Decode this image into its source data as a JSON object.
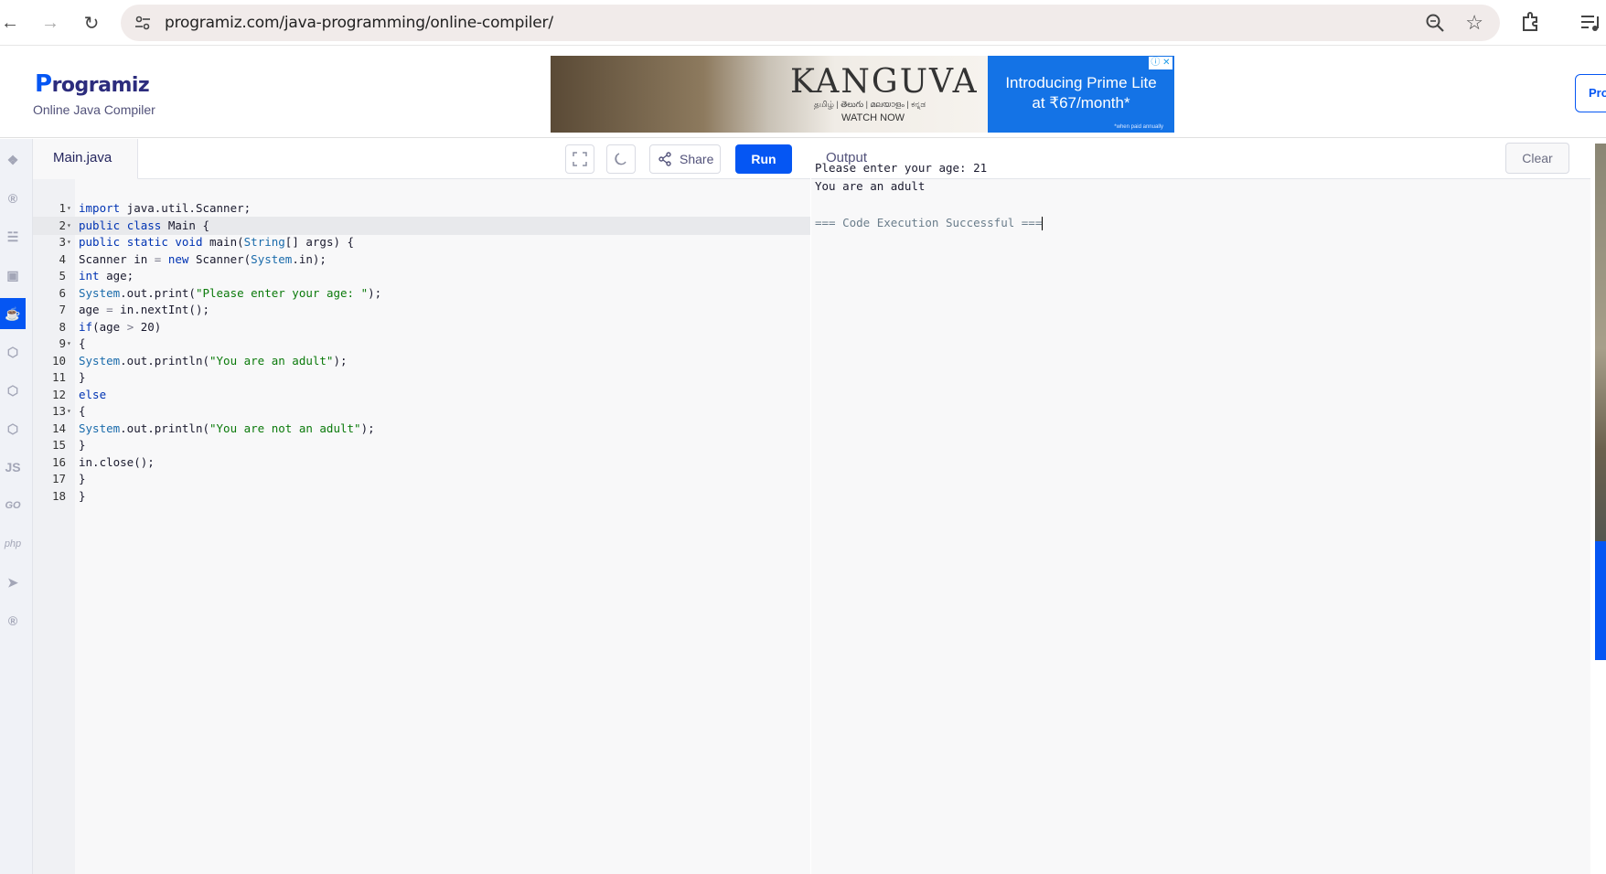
{
  "browser": {
    "url": "programiz.com/java-programming/online-compiler/"
  },
  "header": {
    "logo": "rogramiz",
    "logo_initial": "P",
    "subtitle": "Online Java Compiler",
    "pro_button": "Pro"
  },
  "ad": {
    "title": "KANGUVA",
    "languages": "தமிழ் | తెలుగు | മലയാളം | ಕನ್ನಡ",
    "watch": "WATCH NOW",
    "headline_1": "Introducing Prime Lite",
    "headline_2": "at ₹67/month*",
    "note": "*when paid annually"
  },
  "rail": {
    "items": [
      "python-icon",
      "r-icon",
      "sql-icon",
      "html-icon",
      "java-icon",
      "c-icon",
      "cpp-icon",
      "csharp-icon",
      "js-icon",
      "go-icon",
      "php-icon",
      "swift-icon",
      "rust-icon"
    ],
    "js_label": "JS",
    "go_label": "GO",
    "php_label": "php"
  },
  "editor": {
    "file_tab": "Main.java",
    "share_label": "Share",
    "run_label": "Run",
    "lines": [
      {
        "n": "1",
        "fold": true
      },
      {
        "n": "2",
        "fold": true
      },
      {
        "n": "3",
        "fold": true
      },
      {
        "n": "4"
      },
      {
        "n": "5"
      },
      {
        "n": "6"
      },
      {
        "n": "7"
      },
      {
        "n": "8"
      },
      {
        "n": "9",
        "fold": true
      },
      {
        "n": "10"
      },
      {
        "n": "11"
      },
      {
        "n": "12"
      },
      {
        "n": "13",
        "fold": true
      },
      {
        "n": "14"
      },
      {
        "n": "15"
      },
      {
        "n": "16"
      },
      {
        "n": "17"
      },
      {
        "n": "18"
      }
    ],
    "code": [
      "import java.util.Scanner;",
      "public class Main {",
      "public static void main(String[] args) {",
      "Scanner in = new Scanner(System.in);",
      "int age;",
      "System.out.print(\"Please enter your age: \");",
      "age = in.nextInt();",
      "if(age > 20)",
      "{",
      "System.out.println(\"You are an adult\");",
      "}",
      "else",
      "{",
      "System.out.println(\"You are not an adult\");",
      "}",
      "in.close();",
      "}",
      "}"
    ],
    "active_line": 2
  },
  "output": {
    "title": "Output",
    "clear_label": "Clear",
    "lines": [
      "Please enter your age: 21",
      "You are an adult",
      "",
      "=== Code Execution Successful ==="
    ]
  },
  "colors": {
    "accent": "#0556f3",
    "keyword": "#0033b3",
    "string": "#0b7a0b"
  }
}
